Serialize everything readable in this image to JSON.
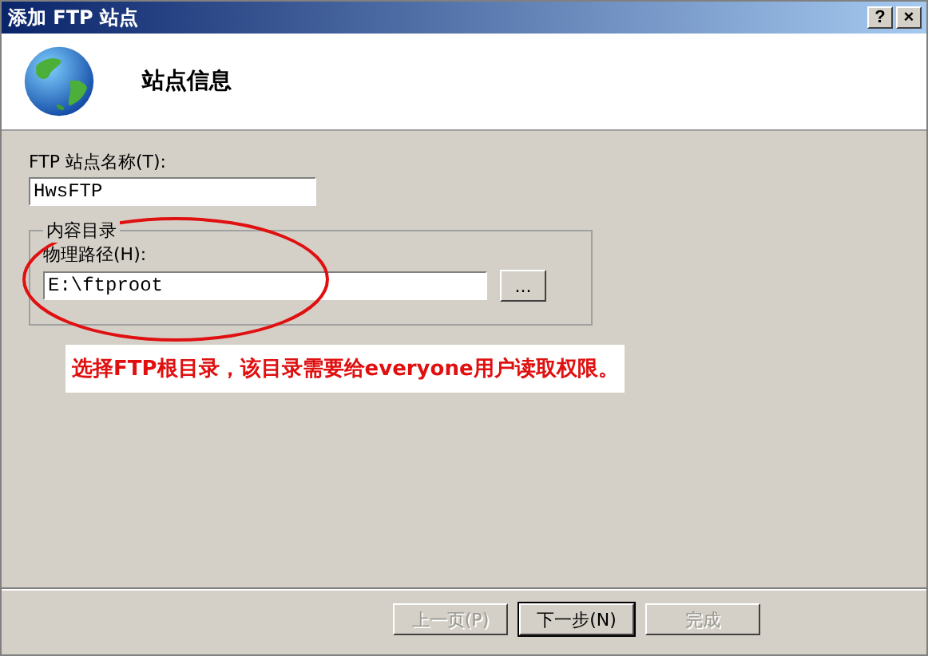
{
  "window": {
    "title": "添加 FTP 站点"
  },
  "title_buttons": [
    {
      "label": "?"
    },
    {
      "label": "×"
    }
  ],
  "header": {
    "title": "站点信息"
  },
  "site_name": {
    "label": "FTP 站点名称(T):",
    "value": "HwsFTP"
  },
  "content_directory": {
    "legend": "内容目录",
    "label": "物理路径(H):",
    "value": "E:\\ftproot",
    "browse": "..."
  },
  "annotation": {
    "text": "选择FTP根目录，该目录需要给everyone用户读取权限。"
  },
  "buttons": [
    {
      "label": "上一页(P)",
      "disabled": true,
      "default": false
    },
    {
      "label": "下一步(N)",
      "disabled": false,
      "default": true
    },
    {
      "label": "完成",
      "disabled": true,
      "default": false
    }
  ]
}
